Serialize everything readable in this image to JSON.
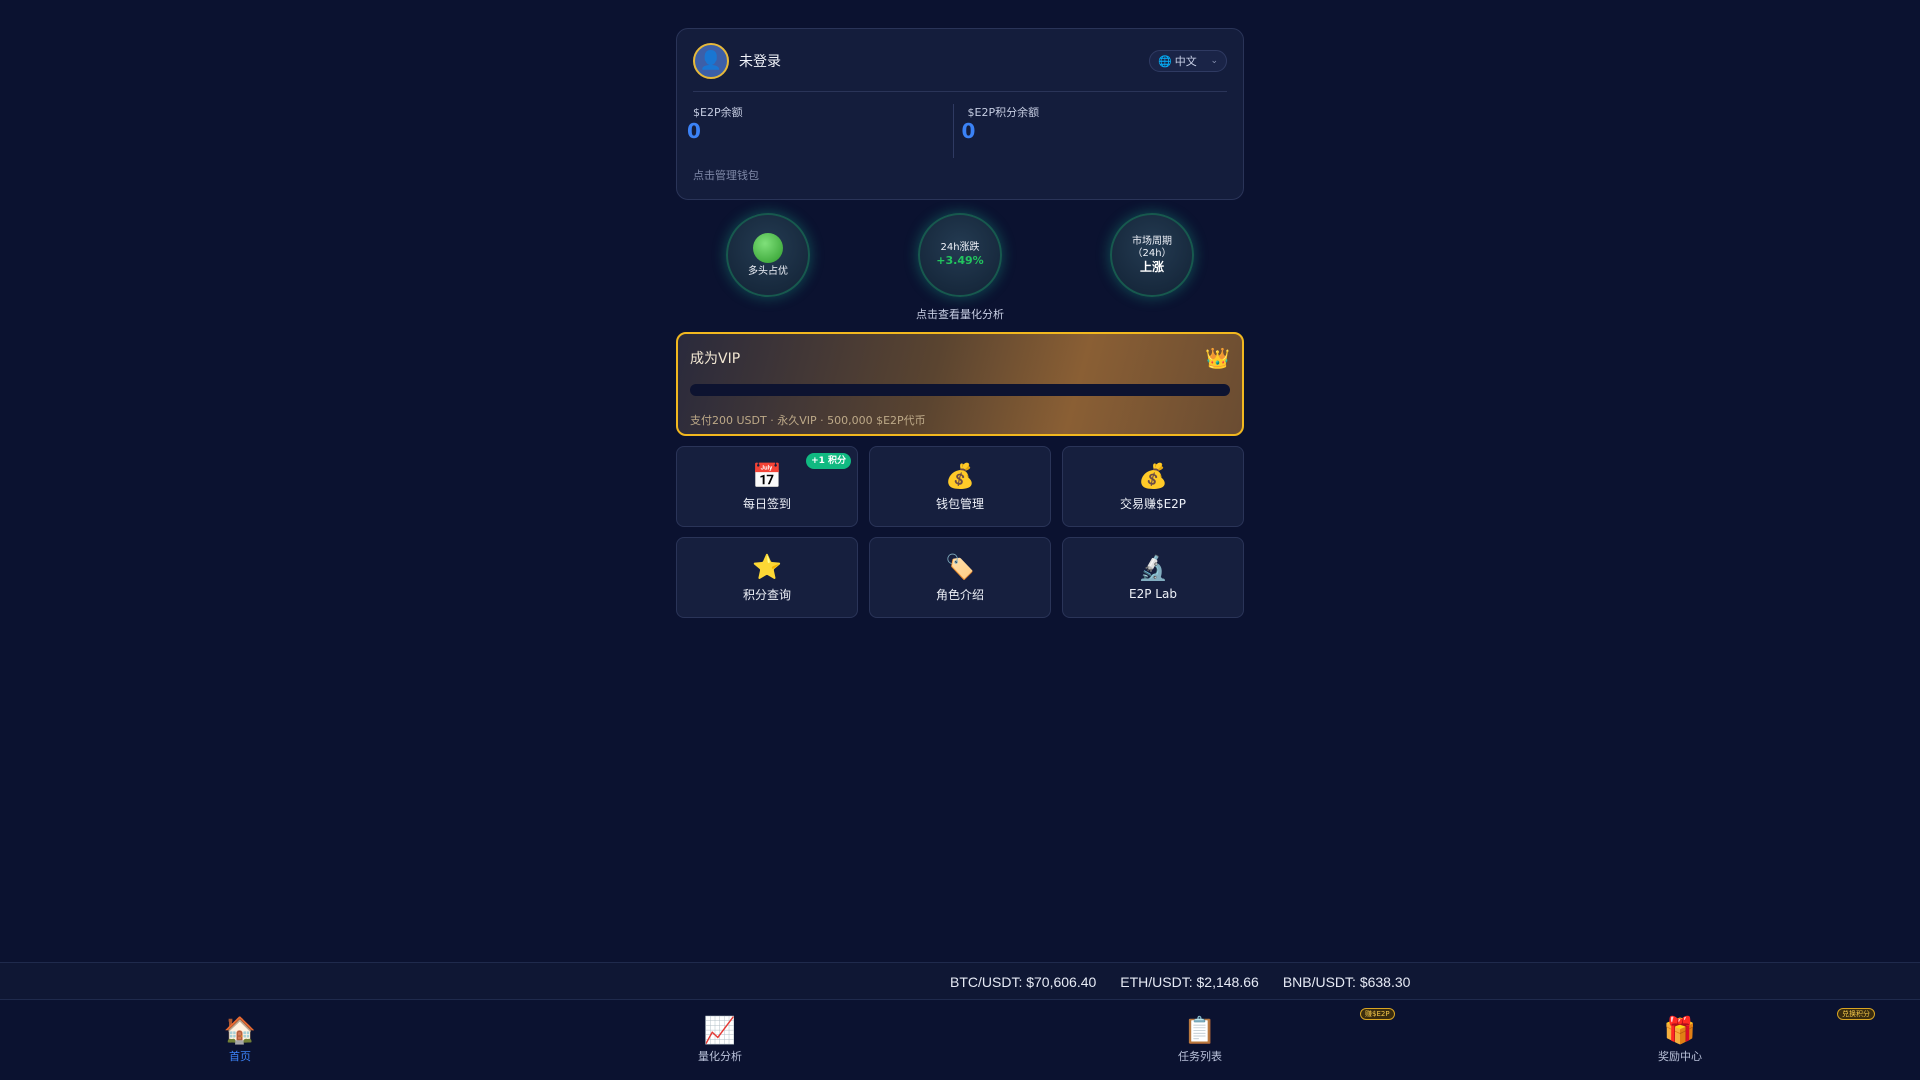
{
  "account": {
    "avatar_icon": "user-avatar-icon",
    "login_status": "未登录",
    "language": {
      "icon": "globe-icon",
      "selected": "中文"
    },
    "balances": [
      {
        "label": "$E2P余额",
        "value": "0"
      },
      {
        "label": "$E2P积分余额",
        "value": "0"
      }
    ],
    "manage_wallet": "点击管理钱包"
  },
  "indicators": {
    "sentiment": {
      "icon": "green-circle-icon",
      "label": "多头占优"
    },
    "change24h": {
      "label": "24h涨跌",
      "value": "+3.49%"
    },
    "cycle": {
      "label_line1": "市场周期",
      "label_line2": "（24h）",
      "value": "上涨"
    },
    "quant_link": "点击查看量化分析"
  },
  "vip": {
    "title": "成为VIP",
    "crown_icon": "crown-icon",
    "progress": 0,
    "description": "支付200 USDT · 永久VIP · 500,000 $E2P代币",
    "accent_color": "#f2b81f"
  },
  "tiles": [
    {
      "icon": "calendar-icon",
      "glyph": "📅",
      "label": "每日签到",
      "badge": "+1 积分"
    },
    {
      "icon": "money-bag-icon",
      "glyph": "💰",
      "label": "钱包管理"
    },
    {
      "icon": "money-bag-icon",
      "glyph": "💰",
      "label": "交易赚$E2P"
    },
    {
      "icon": "star-icon",
      "glyph": "⭐",
      "label": "积分查询"
    },
    {
      "icon": "tag-icon",
      "glyph": "🏷️",
      "label": "角色介绍"
    },
    {
      "icon": "microscope-icon",
      "glyph": "🔬",
      "label": "E2P Lab"
    }
  ],
  "ticker": [
    "BTC/USDT: $70,606.40",
    "ETH/USDT: $2,148.66",
    "BNB/USDT: $638.30"
  ],
  "nav": [
    {
      "icon": "home-icon",
      "glyph": "🏠",
      "label": "首页",
      "active": true
    },
    {
      "icon": "chart-icon",
      "glyph": "📈",
      "label": "量化分析"
    },
    {
      "icon": "clipboard-icon",
      "glyph": "📋",
      "label": "任务列表",
      "badge": "赚$E2P"
    },
    {
      "icon": "gift-icon",
      "glyph": "🎁",
      "label": "奖励中心",
      "badge": "兑换积分"
    }
  ],
  "colors": {
    "background": "#0b1230",
    "accent_blue": "#3b82f6",
    "positive_green": "#22c55e",
    "badge_green": "#10b981"
  }
}
